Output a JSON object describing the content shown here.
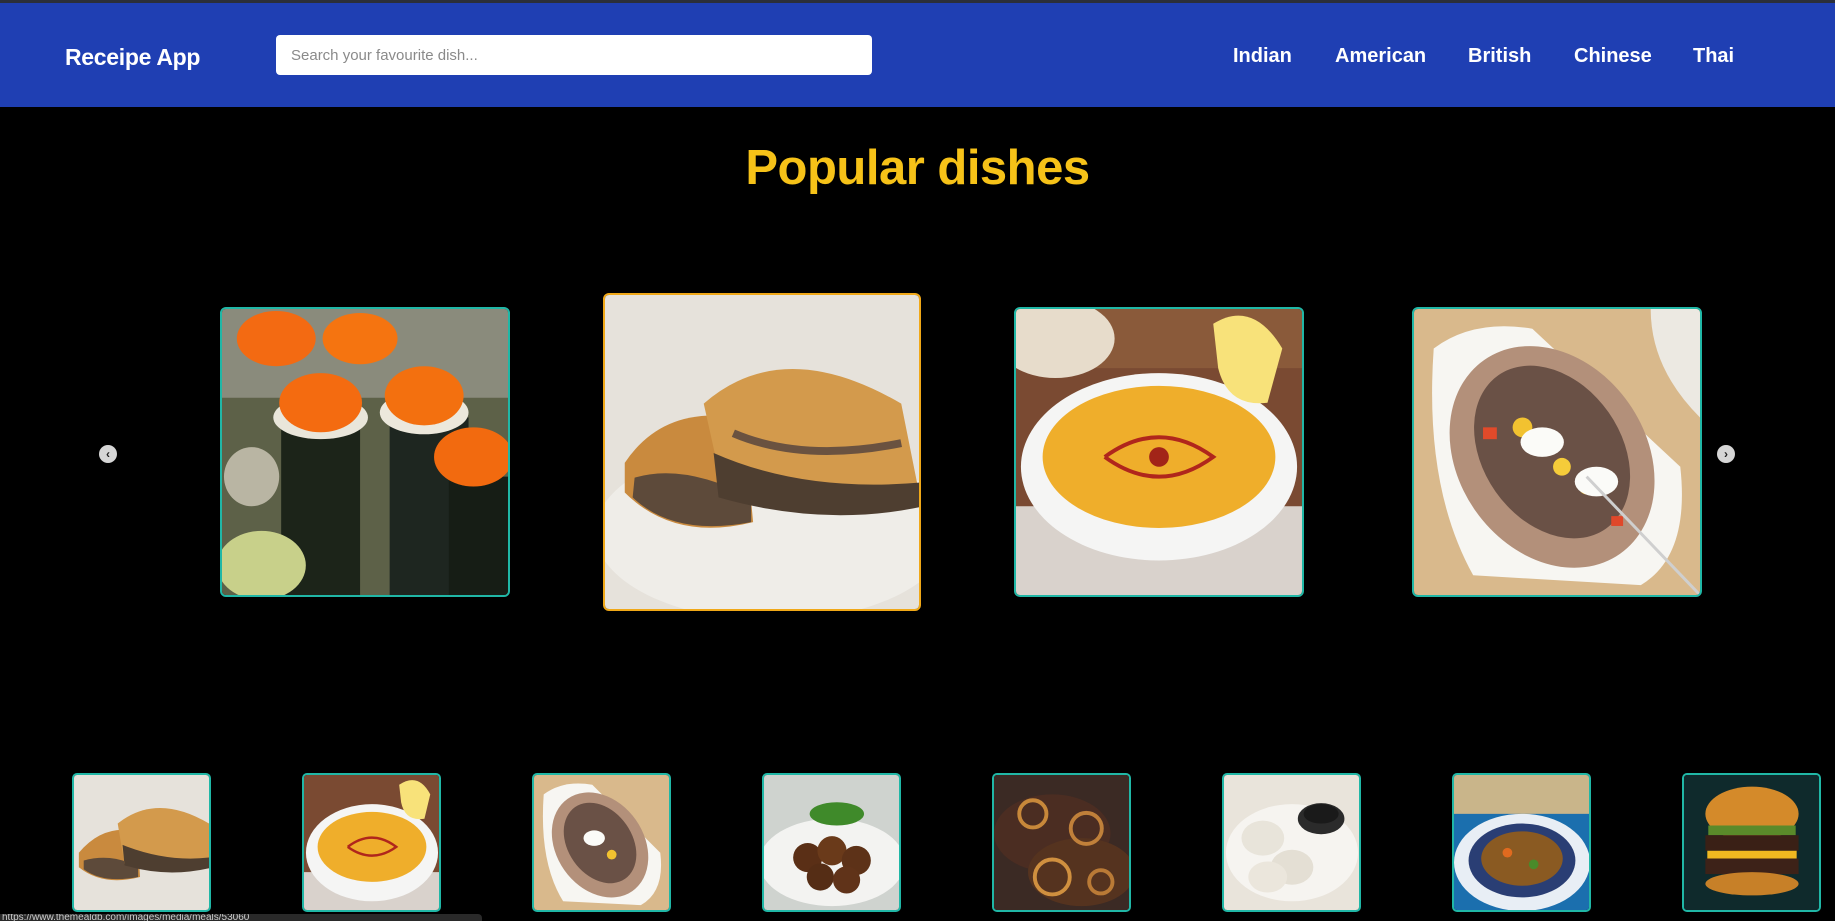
{
  "header": {
    "brand": "Receipe App",
    "search_placeholder": "Search your favourite dish...",
    "nav": [
      "Indian",
      "American",
      "British",
      "Chinese",
      "Thai"
    ]
  },
  "main": {
    "title": "Popular dishes"
  },
  "carousel": {
    "items": [
      "sushi-image",
      "burek-pie-image",
      "lentil-soup-image",
      "stuffed-potato-image"
    ],
    "prev_icon": "chevron-left-icon",
    "next_icon": "chevron-right-icon"
  },
  "thumbnails": [
    "burek-pie-image",
    "lentil-soup-image",
    "stuffed-potato-image",
    "falafel-image",
    "beef-onions-image",
    "dumplings-image",
    "stew-bowl-image",
    "burger-image"
  ],
  "statusbar": {
    "url": "https://www.themealdb.com/images/media/meals/53060"
  },
  "colors": {
    "header_bg": "#1f3fb3",
    "title": "#f6c218",
    "card_border": "#20b7a6",
    "active_border": "#f0a818"
  }
}
